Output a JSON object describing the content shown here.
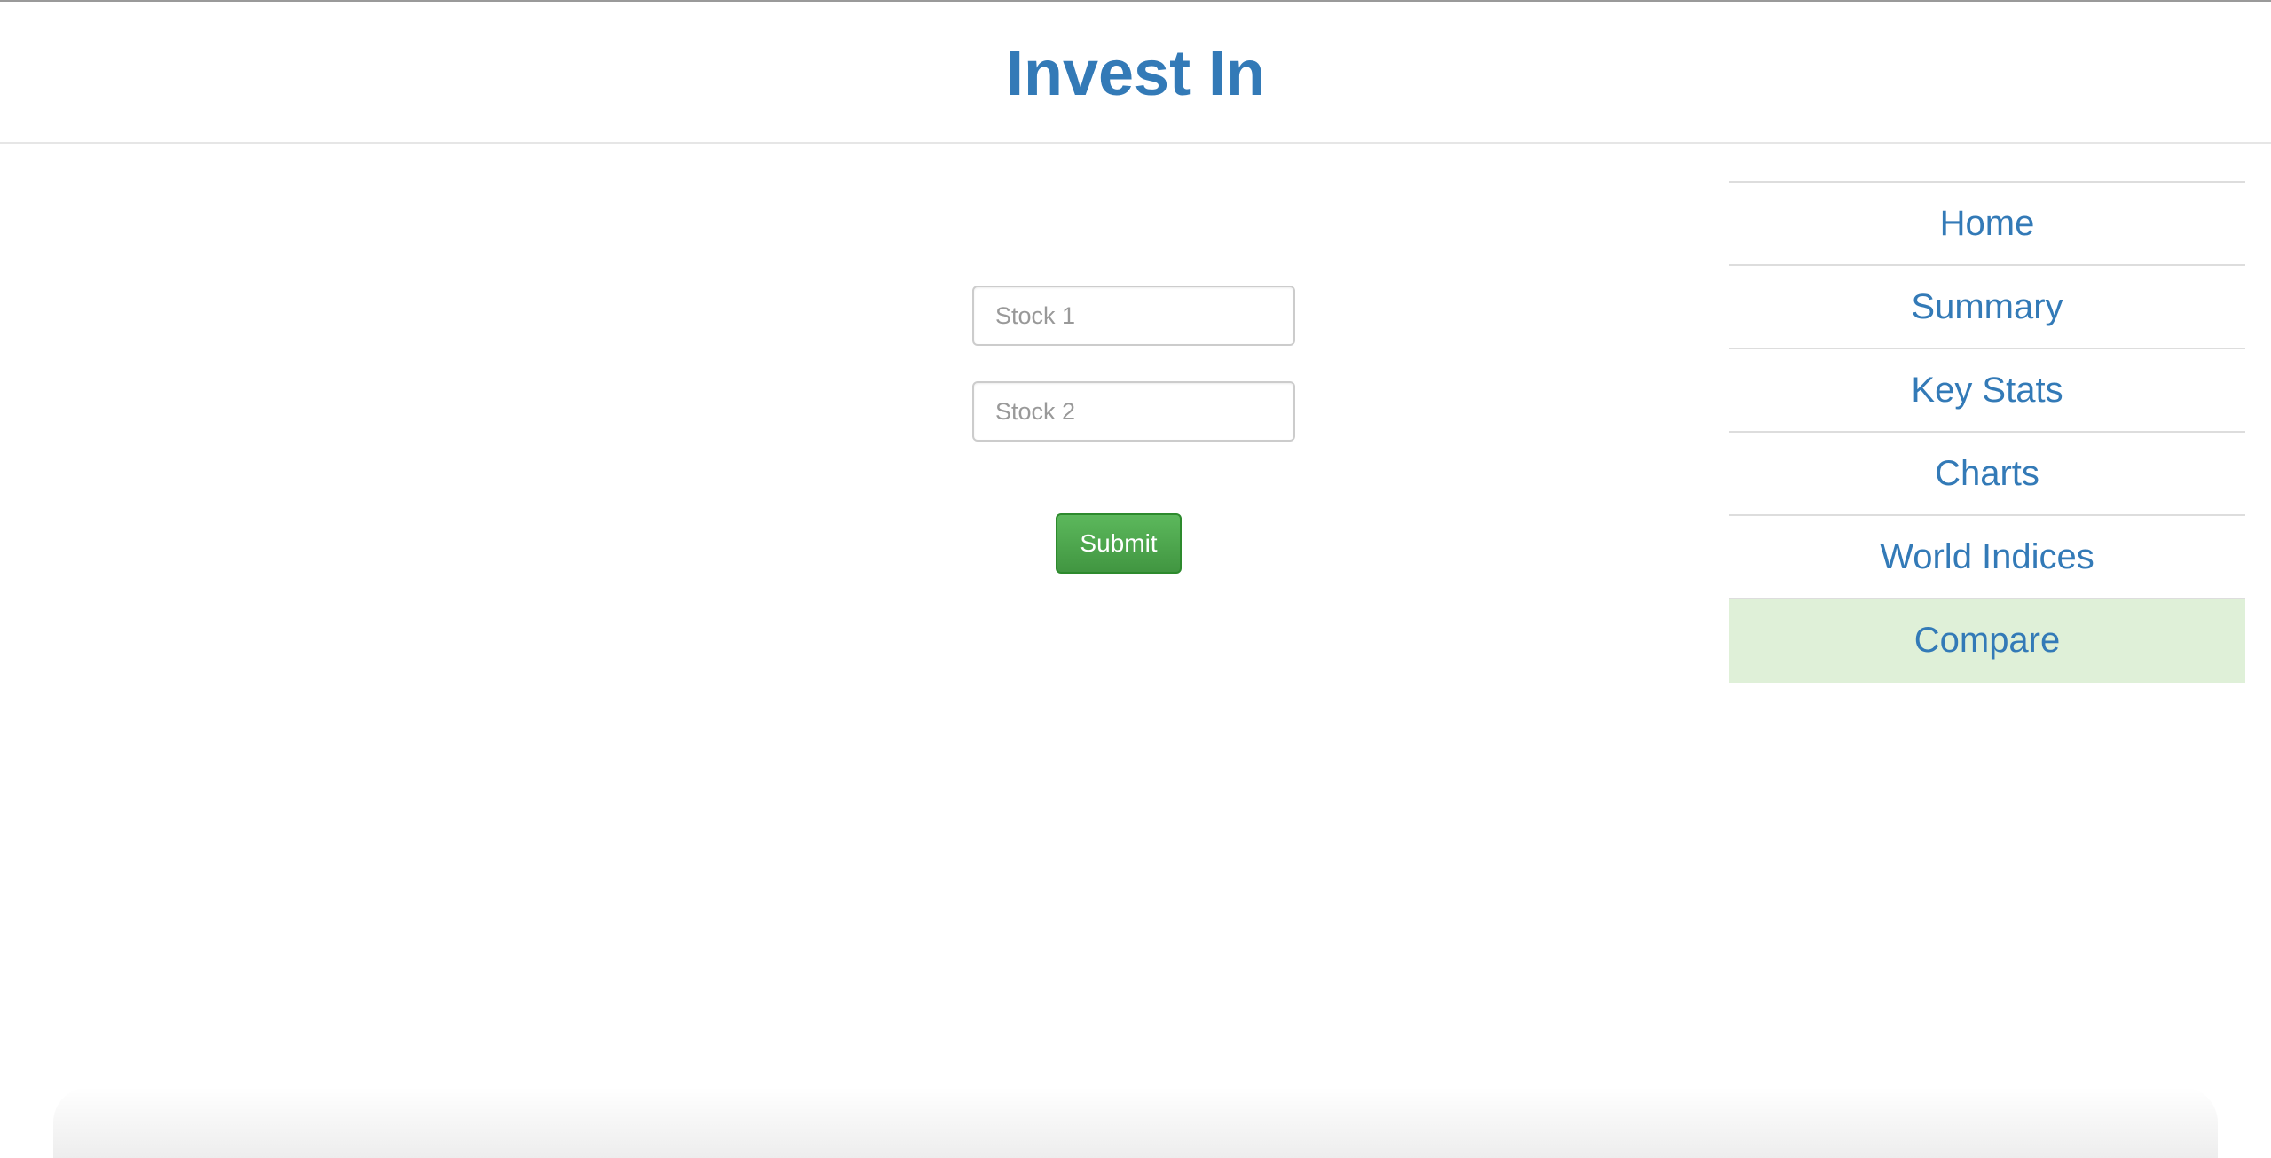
{
  "header": {
    "title": "Invest In"
  },
  "form": {
    "stock1_placeholder": "Stock 1",
    "stock1_value": "",
    "stock2_placeholder": "Stock 2",
    "stock2_value": "",
    "submit_label": "Submit"
  },
  "sidebar": {
    "items": [
      {
        "label": "Home",
        "active": false
      },
      {
        "label": "Summary",
        "active": false
      },
      {
        "label": "Key Stats",
        "active": false
      },
      {
        "label": "Charts",
        "active": false
      },
      {
        "label": "World Indices",
        "active": false
      },
      {
        "label": "Compare",
        "active": true
      }
    ]
  },
  "colors": {
    "accent": "#337ab7",
    "submit": "#5cb85c",
    "active_item": "#dff0d8"
  }
}
